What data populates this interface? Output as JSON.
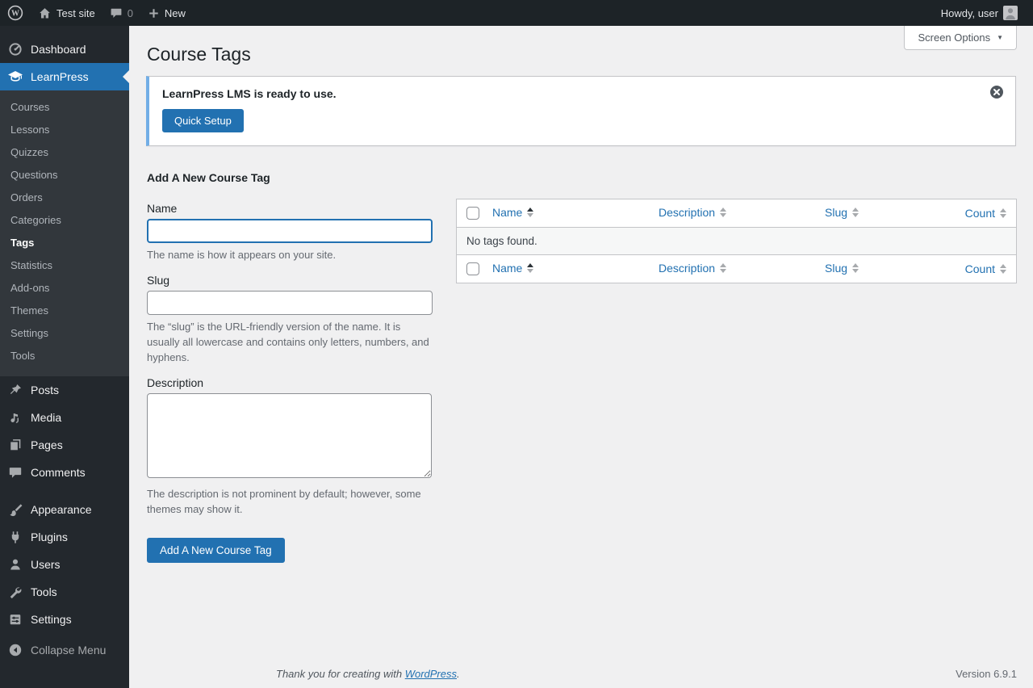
{
  "admin_bar": {
    "site_name": "Test site",
    "comments_count": "0",
    "new_label": "New",
    "howdy": "Howdy, user"
  },
  "sidebar": {
    "dashboard_label": "Dashboard",
    "learnpress_label": "LearnPress",
    "learnpress_submenu": [
      "Courses",
      "Lessons",
      "Quizzes",
      "Questions",
      "Orders",
      "Categories",
      "Tags",
      "Statistics",
      "Add-ons",
      "Themes",
      "Settings",
      "Tools"
    ],
    "current_submenu_item": "Tags",
    "main_items": [
      "Posts",
      "Media",
      "Pages",
      "Comments"
    ],
    "lower_items": [
      "Appearance",
      "Plugins",
      "Users",
      "Tools",
      "Settings"
    ],
    "collapse_label": "Collapse Menu"
  },
  "page": {
    "title": "Course Tags",
    "screen_options_label": "Screen Options"
  },
  "notice": {
    "message": "LearnPress LMS is ready to use.",
    "button_label": "Quick Setup"
  },
  "form": {
    "heading": "Add A New Course Tag",
    "name_label": "Name",
    "name_value": "",
    "name_help": "The name is how it appears on your site.",
    "slug_label": "Slug",
    "slug_value": "",
    "slug_help": "The “slug” is the URL-friendly version of the name. It is usually all lowercase and contains only letters, numbers, and hyphens.",
    "description_label": "Description",
    "description_value": "",
    "description_help": "The description is not prominent by default; however, some themes may show it.",
    "submit_label": "Add A New Course Tag"
  },
  "table": {
    "columns": [
      "Name",
      "Description",
      "Slug",
      "Count"
    ],
    "sorted_column": "Name",
    "sort_direction": "asc",
    "empty_message": "No tags found."
  },
  "footer": {
    "thanks_prefix": "Thank you for creating with ",
    "thanks_link": "WordPress",
    "thanks_suffix": ".",
    "version": "Version 6.9.1"
  },
  "colors": {
    "accent": "#2271b1",
    "notice_border": "#72aee6",
    "admin_bar_bg": "#1d2327",
    "menu_bg": "#23282d",
    "submenu_bg": "#32373c",
    "content_bg": "#f0f0f1"
  }
}
